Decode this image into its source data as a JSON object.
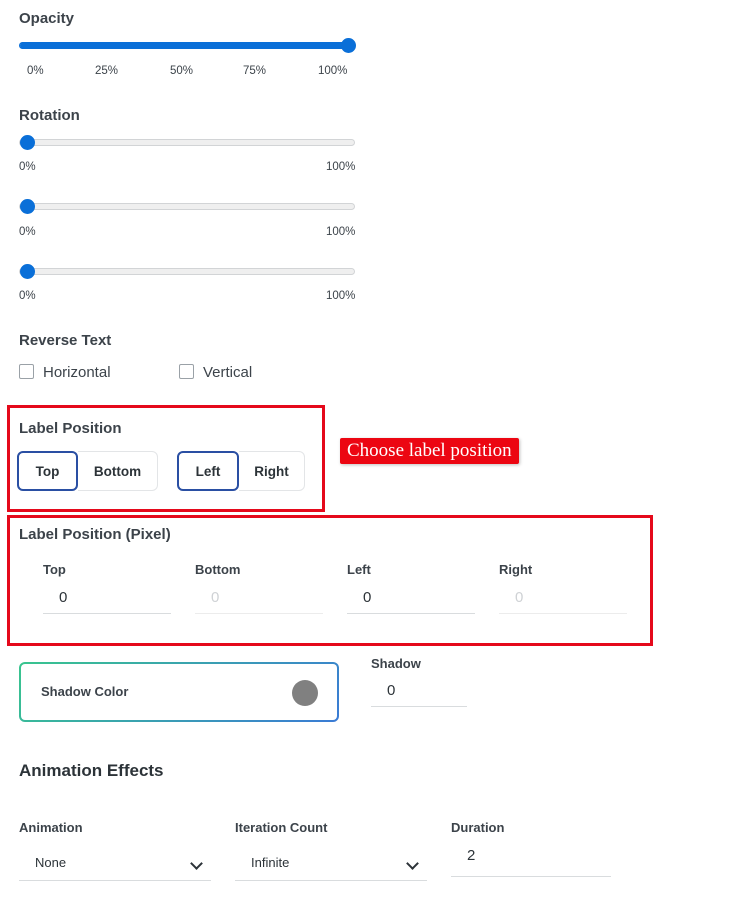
{
  "opacity": {
    "title": "Opacity",
    "value_percent": 100,
    "ticks": [
      "0%",
      "25%",
      "50%",
      "75%",
      "100%"
    ]
  },
  "rotation": {
    "title": "Rotation",
    "sliders": [
      {
        "value_percent": 0,
        "min_label": "0%",
        "max_label": "100%"
      },
      {
        "value_percent": 0,
        "min_label": "0%",
        "max_label": "100%"
      },
      {
        "value_percent": 0,
        "min_label": "0%",
        "max_label": "100%"
      }
    ]
  },
  "reverse_text": {
    "title": "Reverse Text",
    "horizontal_label": "Horizontal",
    "horizontal_checked": false,
    "vertical_label": "Vertical",
    "vertical_checked": false
  },
  "label_position": {
    "title": "Label Position",
    "vertical_options": [
      "Top",
      "Bottom"
    ],
    "vertical_selected": "Top",
    "horizontal_options": [
      "Left",
      "Right"
    ],
    "horizontal_selected": "Left"
  },
  "callout": {
    "text": "Choose label position"
  },
  "label_position_pixel": {
    "title": "Label Position (Pixel)",
    "fields": [
      {
        "label": "Top",
        "value": "0",
        "enabled": true
      },
      {
        "label": "Bottom",
        "value": "0",
        "enabled": false
      },
      {
        "label": "Left",
        "value": "0",
        "enabled": true
      },
      {
        "label": "Right",
        "value": "0",
        "enabled": false
      }
    ]
  },
  "shadow": {
    "color_label": "Shadow Color",
    "color_value": "#808080",
    "shadow_label": "Shadow",
    "shadow_value": "0"
  },
  "animation": {
    "title": "Animation Effects",
    "animation_label": "Animation",
    "animation_value": "None",
    "iteration_label": "Iteration Count",
    "iteration_value": "Infinite",
    "duration_label": "Duration",
    "duration_value": "2"
  },
  "colors": {
    "accent": "#0a6fd8",
    "highlight_red": "#e5091b",
    "selected_border": "#2a4fa3"
  }
}
